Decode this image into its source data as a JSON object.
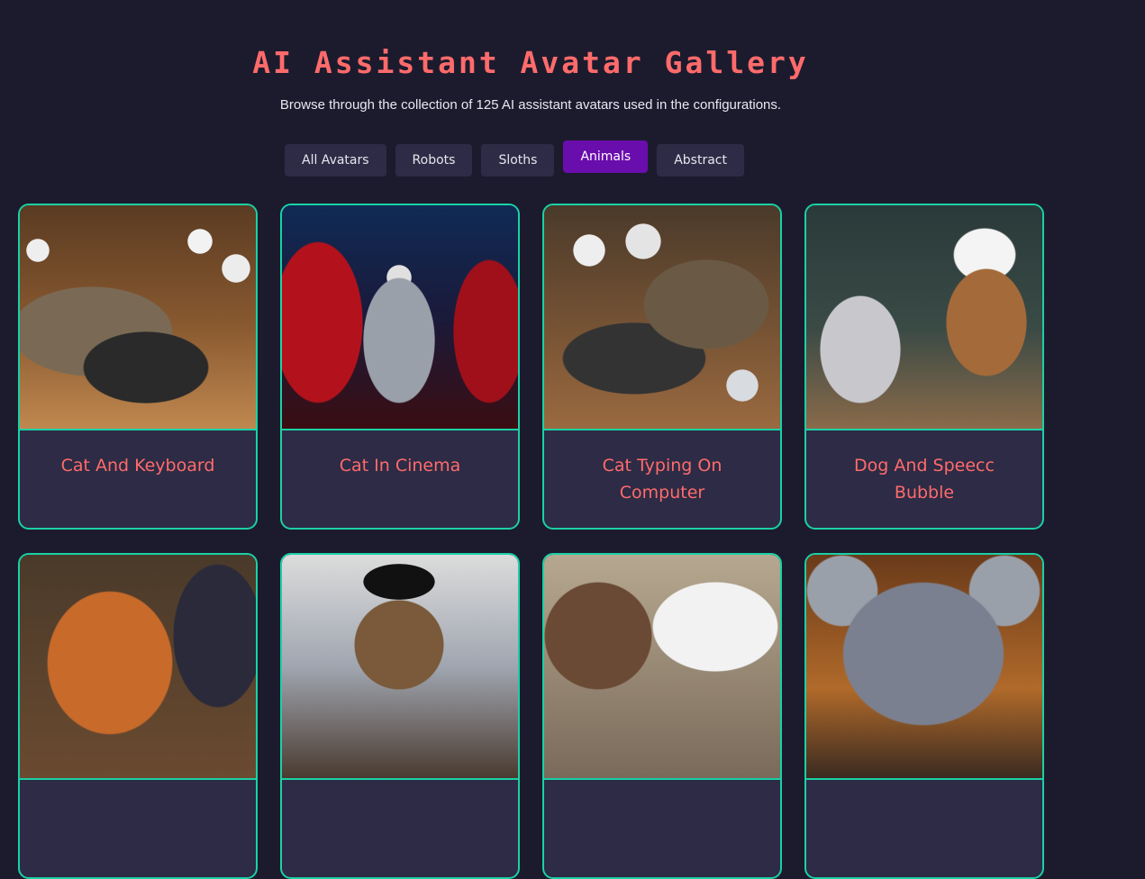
{
  "header": {
    "title": "AI Assistant Avatar Gallery",
    "subtitle": "Browse through the collection of 125 AI assistant avatars used in the configurations."
  },
  "filters": [
    {
      "label": "All Avatars",
      "active": false
    },
    {
      "label": "Robots",
      "active": false
    },
    {
      "label": "Sloths",
      "active": false
    },
    {
      "label": "Animals",
      "active": true
    },
    {
      "label": "Abstract",
      "active": false
    }
  ],
  "avatars": [
    {
      "name": "Cat And Keyboard"
    },
    {
      "name": "Cat In Cinema"
    },
    {
      "name": "Cat Typing On Computer"
    },
    {
      "name": "Dog And Speecc Bubble"
    },
    {
      "name": ""
    },
    {
      "name": ""
    },
    {
      "name": ""
    },
    {
      "name": ""
    }
  ],
  "colors": {
    "background": "#1c1b2e",
    "accent_text": "#ff6b6b",
    "card_border": "#1ad1a5",
    "card_bg": "#2d2b45",
    "active_filter": "#6a0dad"
  }
}
